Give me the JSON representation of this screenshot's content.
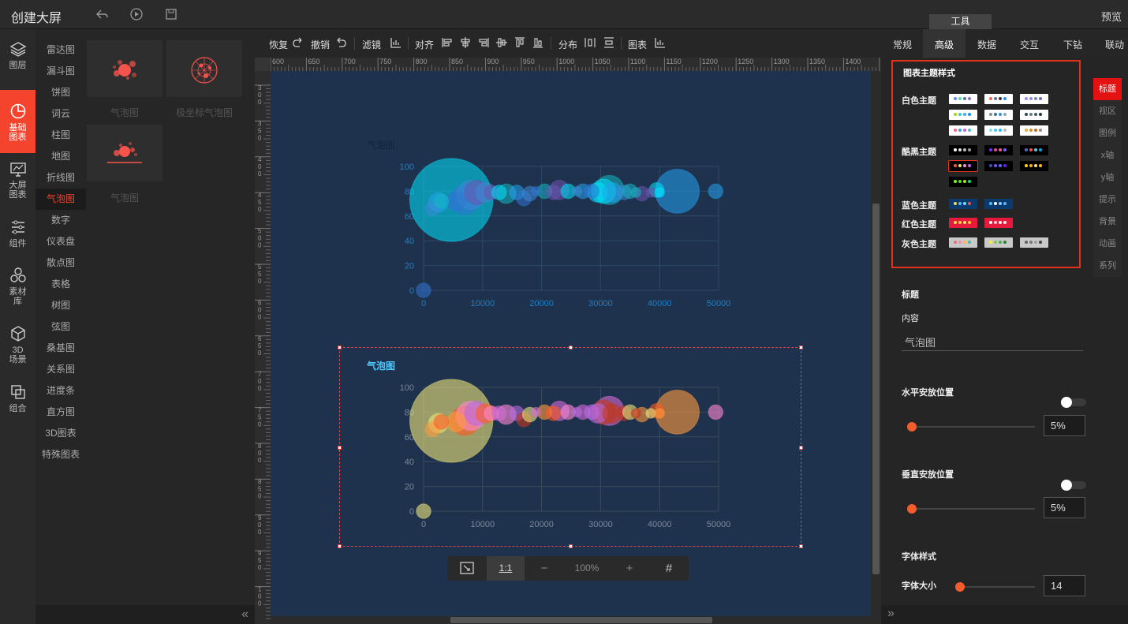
{
  "app": {
    "title": "创建大屏",
    "preview": "预览",
    "tools_tab": "工具"
  },
  "leftnav": [
    {
      "id": "layers",
      "label": "图层"
    },
    {
      "id": "basic-charts",
      "label": "基础\n图表"
    },
    {
      "id": "screen-charts",
      "label": "大屏\n图表"
    },
    {
      "id": "components",
      "label": "组件"
    },
    {
      "id": "assets",
      "label": "素材\n库"
    },
    {
      "id": "3d",
      "label": "3D\n场景"
    },
    {
      "id": "group",
      "label": "组合"
    }
  ],
  "categories": [
    "雷达图",
    "漏斗图",
    "饼图",
    "词云",
    "柱图",
    "地图",
    "折线图",
    "气泡图",
    "数字",
    "仪表盘",
    "散点图",
    "表格",
    "树图",
    "弦图",
    "桑基图",
    "关系图",
    "进度条",
    "直方图",
    "3D图表",
    "特殊图表"
  ],
  "active_category": "气泡图",
  "thumbs": [
    {
      "label": "气泡图"
    },
    {
      "label": "极坐标气泡图"
    },
    {
      "label": "气泡图"
    }
  ],
  "toolbar": {
    "redo": "恢复",
    "undo": "撤销",
    "filter": "滤镜",
    "align": "对齐",
    "distribute": "分布",
    "chart": "图表"
  },
  "ruler": {
    "top": [
      "600",
      "650",
      "700",
      "750",
      "800",
      "850",
      "900",
      "950",
      "1000",
      "1050",
      "1100",
      "1150",
      "1200",
      "1250",
      "1300",
      "1350",
      "1400",
      "14"
    ],
    "left": [
      "300",
      "350",
      "400",
      "450",
      "500",
      "550",
      "600",
      "650",
      "700",
      "750",
      "800",
      "850",
      "900",
      "950",
      "100"
    ]
  },
  "zoombar": {
    "fit": "⤢",
    "one_to_one": "1:1",
    "minus": "−",
    "zoom": "100%",
    "plus": "+",
    "grid": "#"
  },
  "right_tabs": [
    "常规",
    "高级",
    "数据",
    "交互",
    "下钻",
    "联动"
  ],
  "active_right_tab": "高级",
  "theme": {
    "title": "图表主题样式",
    "categories": [
      "白色主题",
      "酷黑主题",
      "蓝色主题",
      "红色主题",
      "灰色主题"
    ]
  },
  "side_tabs": [
    "标题",
    "视区",
    "图例",
    "x轴",
    "y轴",
    "提示",
    "背景",
    "动画",
    "系列"
  ],
  "active_side_tab": "标题",
  "props": {
    "title_section": "标题",
    "content_label": "内容",
    "content_value": "气泡图",
    "h_pos_label": "水平安放位置",
    "h_pos_value": "5%",
    "v_pos_label": "垂直安放位置",
    "v_pos_value": "5%",
    "font_style_label": "字体样式",
    "font_size_label": "字体大小",
    "font_size_value": "14"
  },
  "chart_data": [
    {
      "type": "scatter",
      "title": "气泡图",
      "xlim": [
        0,
        50000
      ],
      "ylim": [
        0,
        100
      ],
      "x_ticks": [
        "0",
        "10000",
        "20000",
        "30000",
        "40000",
        "50000"
      ],
      "y_ticks": [
        "0",
        "20",
        "40",
        "60",
        "80",
        "100"
      ],
      "points": [
        [
          0,
          0,
          3
        ],
        [
          1500,
          66,
          3
        ],
        [
          2500,
          71,
          4
        ],
        [
          4700,
          73,
          17
        ],
        [
          3000,
          72,
          3
        ],
        [
          5500,
          72,
          4
        ],
        [
          7000,
          73,
          6
        ],
        [
          8000,
          77,
          6
        ],
        [
          9000,
          79,
          5
        ],
        [
          10500,
          79,
          4
        ],
        [
          11500,
          79,
          3
        ],
        [
          12800,
          79,
          3
        ],
        [
          14000,
          78,
          4
        ],
        [
          15800,
          79,
          3
        ],
        [
          17000,
          74,
          3
        ],
        [
          18000,
          78,
          3
        ],
        [
          19000,
          80,
          2
        ],
        [
          20500,
          80,
          3
        ],
        [
          22000,
          79,
          3
        ],
        [
          23000,
          81,
          4
        ],
        [
          24500,
          80,
          3
        ],
        [
          26000,
          80,
          2
        ],
        [
          27000,
          80,
          3
        ],
        [
          28500,
          80,
          3
        ],
        [
          29500,
          79,
          4
        ],
        [
          31500,
          81,
          6
        ],
        [
          30500,
          80,
          5
        ],
        [
          32000,
          79,
          4
        ],
        [
          34000,
          79,
          3
        ],
        [
          35000,
          80,
          3
        ],
        [
          36000,
          79,
          2
        ],
        [
          37000,
          78,
          3
        ],
        [
          38500,
          79,
          2
        ],
        [
          39500,
          81,
          3
        ],
        [
          40000,
          79,
          2
        ],
        [
          43000,
          80,
          9
        ],
        [
          49500,
          80,
          3
        ]
      ],
      "colors": [
        "#00e3ff",
        "#22a2f3",
        "#2f74d6",
        "#3d8bd6",
        "#14b6c5",
        "#6b53b0"
      ]
    },
    {
      "type": "scatter",
      "title": "气泡图",
      "xlim": [
        0,
        50000
      ],
      "ylim": [
        0,
        100
      ],
      "x_ticks": [
        "0",
        "10000",
        "20000",
        "30000",
        "40000",
        "50000"
      ],
      "y_ticks": [
        "0",
        "20",
        "40",
        "60",
        "80",
        "100"
      ],
      "points": [
        [
          0,
          0,
          3
        ],
        [
          1500,
          66,
          3
        ],
        [
          2500,
          71,
          4
        ],
        [
          4700,
          73,
          17
        ],
        [
          3000,
          72,
          3
        ],
        [
          5500,
          72,
          4
        ],
        [
          7000,
          73,
          6
        ],
        [
          8000,
          77,
          6
        ],
        [
          9000,
          79,
          5
        ],
        [
          10500,
          79,
          4
        ],
        [
          11500,
          79,
          3
        ],
        [
          12800,
          79,
          3
        ],
        [
          14000,
          78,
          4
        ],
        [
          15800,
          79,
          3
        ],
        [
          17000,
          74,
          3
        ],
        [
          18000,
          78,
          3
        ],
        [
          19000,
          80,
          2
        ],
        [
          20500,
          80,
          3
        ],
        [
          22000,
          79,
          3
        ],
        [
          23000,
          81,
          4
        ],
        [
          24500,
          80,
          3
        ],
        [
          26000,
          80,
          2
        ],
        [
          27000,
          80,
          3
        ],
        [
          28500,
          80,
          3
        ],
        [
          29500,
          79,
          4
        ],
        [
          31500,
          81,
          6
        ],
        [
          30500,
          80,
          5
        ],
        [
          32000,
          79,
          4
        ],
        [
          34000,
          79,
          3
        ],
        [
          35000,
          80,
          3
        ],
        [
          36000,
          79,
          2
        ],
        [
          37000,
          78,
          3
        ],
        [
          38500,
          79,
          2
        ],
        [
          39500,
          81,
          3
        ],
        [
          40000,
          79,
          2
        ],
        [
          43000,
          80,
          9
        ],
        [
          49500,
          80,
          3
        ]
      ],
      "colors": [
        "#ece47a",
        "#ff9a3d",
        "#ff5a21",
        "#ff88d4",
        "#d56bd8",
        "#b86be0",
        "#c13920"
      ]
    }
  ]
}
